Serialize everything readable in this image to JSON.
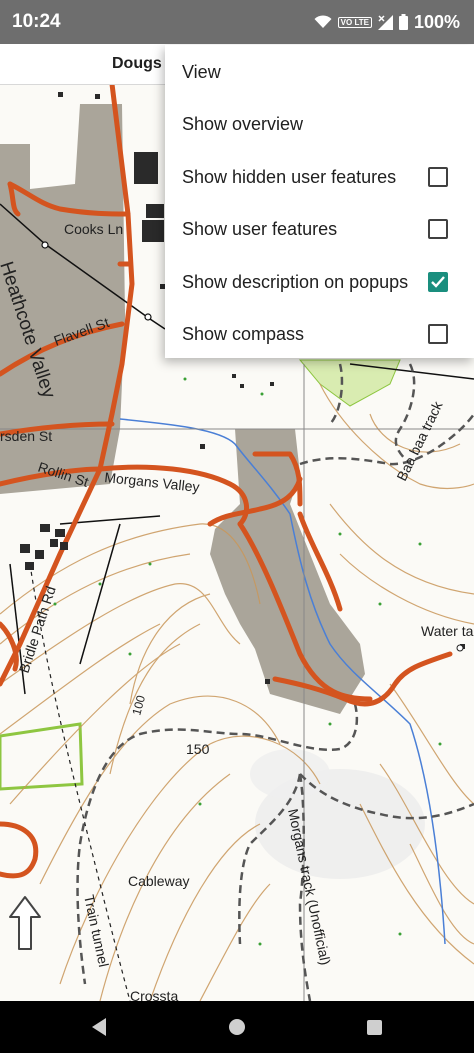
{
  "status": {
    "time": "10:24",
    "battery": "100%",
    "network_badge": "VO LTE",
    "icons": [
      "wifi-icon",
      "signal-icon",
      "battery-icon"
    ]
  },
  "title": "Dougs",
  "menu": {
    "title": "View",
    "items": [
      {
        "label": "Show overview",
        "has_checkbox": false
      },
      {
        "label": "Show hidden user features",
        "has_checkbox": true,
        "checked": false
      },
      {
        "label": "Show user features",
        "has_checkbox": true,
        "checked": false
      },
      {
        "label": "Show description on popups",
        "has_checkbox": true,
        "checked": true
      },
      {
        "label": "Show compass",
        "has_checkbox": true,
        "checked": false
      }
    ]
  },
  "map": {
    "labels": {
      "cooks_ln": "Cooks Ln",
      "heathcote_valley": "Heathcote Valley",
      "flavell_st": "Flavell St",
      "marsden_st": "rsden St",
      "rollin_st": "Rollin St",
      "morgans_valley": "Morgans Valley",
      "bridle_path_rd": "Bridle Path Rd",
      "baa_baa_track": "Baa baa track",
      "water_tank": "Water ta",
      "contour_100": "100",
      "contour_150": "150",
      "morgans_track": "Morgans track (Unofficial)",
      "cableway": "Cableway",
      "train_tunnel": "Train tunnel",
      "bottom_label": "Crossta"
    },
    "colors": {
      "road": "#d4541f",
      "built_up": "#aaa59a",
      "contour": "#c9975a",
      "stream": "#4a7fd6",
      "park": "#8ec641",
      "background": "#fbfaf6"
    }
  },
  "nav": {
    "icons": [
      "back-icon",
      "home-icon",
      "recents-icon"
    ]
  },
  "accent_color": "#1a8e7e"
}
